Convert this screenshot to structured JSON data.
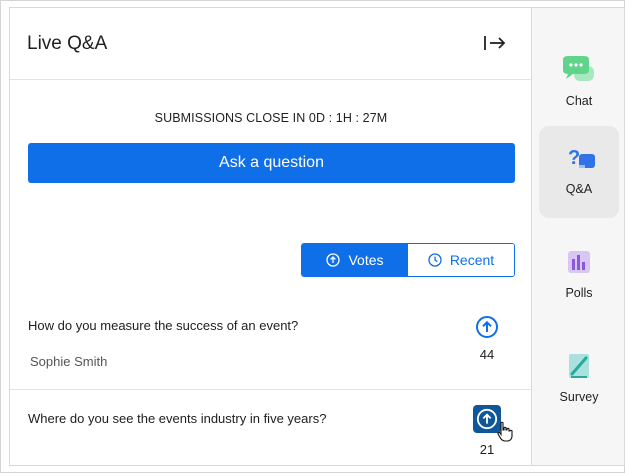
{
  "panel": {
    "title": "Live Q&A",
    "collapse_icon": "collapse-right-icon",
    "countdown": "SUBMISSIONS CLOSE IN 0D : 1H : 27M",
    "ask_button": "Ask a question"
  },
  "sort_toggle": {
    "options": [
      {
        "label": "Votes",
        "icon": "upvote-circle-icon",
        "active": true
      },
      {
        "label": "Recent",
        "icon": "clock-icon",
        "active": false
      }
    ]
  },
  "questions": [
    {
      "text": "How do you measure the success of an event?",
      "author": "Sophie Smith",
      "votes": "44"
    },
    {
      "text": "Where do you see the events industry in five years?",
      "author": "",
      "votes": "21"
    }
  ],
  "rail": {
    "items": [
      {
        "label": "Chat",
        "icon": "chat-bubble-icon",
        "active": false
      },
      {
        "label": "Q&A",
        "icon": "qa-icon",
        "active": true
      },
      {
        "label": "Polls",
        "icon": "polls-icon",
        "active": false
      },
      {
        "label": "Survey",
        "icon": "survey-icon",
        "active": false
      }
    ]
  },
  "colors": {
    "accent": "#0e6fe8",
    "vote_hover": "#10579a",
    "chat_icon": "#5fd48a",
    "qa_icon": "#2f73e6",
    "polls_icon": "#8d58d6",
    "survey_icon": "#29a8a0"
  }
}
